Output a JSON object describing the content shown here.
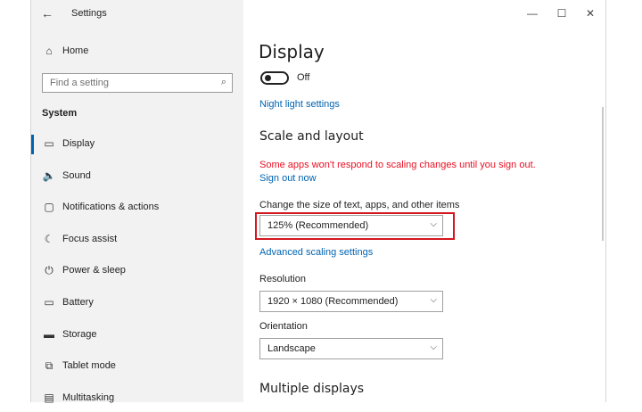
{
  "window": {
    "title": "Settings"
  },
  "sidebar": {
    "home_label": "Home",
    "search_placeholder": "Find a setting",
    "section_heading": "System",
    "items": [
      {
        "label": "Display",
        "icon": "monitor-icon"
      },
      {
        "label": "Sound",
        "icon": "speaker-icon"
      },
      {
        "label": "Notifications & actions",
        "icon": "notification-icon"
      },
      {
        "label": "Focus assist",
        "icon": "moon-icon"
      },
      {
        "label": "Power & sleep",
        "icon": "power-icon"
      },
      {
        "label": "Battery",
        "icon": "battery-icon"
      },
      {
        "label": "Storage",
        "icon": "storage-icon"
      },
      {
        "label": "Tablet mode",
        "icon": "tablet-icon"
      },
      {
        "label": "Multitasking",
        "icon": "multitasking-icon"
      }
    ]
  },
  "main": {
    "title": "Display",
    "night_light_toggle_state": "Off",
    "night_light_link": "Night light settings",
    "scale_heading": "Scale and layout",
    "scale_warning": "Some apps won't respond to scaling changes until you sign out.",
    "sign_out_link": "Sign out now",
    "size_label": "Change the size of text, apps, and other items",
    "size_value": "125% (Recommended)",
    "advanced_link": "Advanced scaling settings",
    "resolution_label": "Resolution",
    "resolution_value": "1920 × 1080 (Recommended)",
    "orientation_label": "Orientation",
    "orientation_value": "Landscape",
    "multiple_heading": "Multiple displays"
  },
  "colors": {
    "accent": "#0063b1",
    "warning": "#e81123",
    "highlight": "#d2171e"
  }
}
